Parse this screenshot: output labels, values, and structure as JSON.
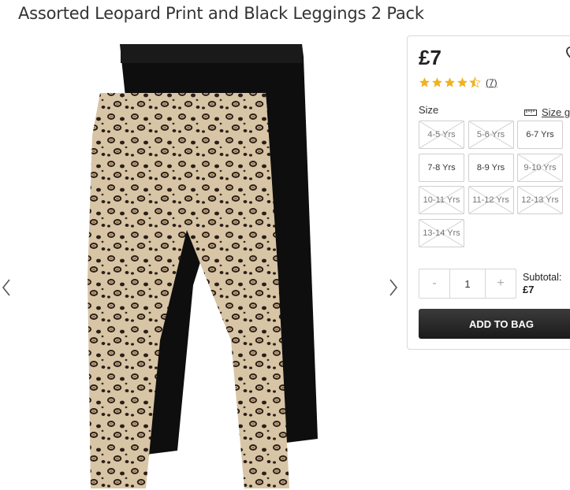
{
  "product": {
    "title": "Assorted Leopard Print and Black Leggings 2 Pack",
    "price": "£7",
    "rating": 4.5,
    "review_count": "(7)"
  },
  "size_section": {
    "label": "Size",
    "guide_label": "Size gu",
    "options": [
      {
        "label": "4-5 Yrs",
        "available": false
      },
      {
        "label": "5-6 Yrs",
        "available": false
      },
      {
        "label": "6-7 Yrs",
        "available": true
      },
      {
        "label": "7-8 Yrs",
        "available": true
      },
      {
        "label": "8-9 Yrs",
        "available": true
      },
      {
        "label": "9-10 Yrs",
        "available": false
      },
      {
        "label": "10-11 Yrs",
        "available": false
      },
      {
        "label": "11-12 Yrs",
        "available": false
      },
      {
        "label": "12-13 Yrs",
        "available": false
      },
      {
        "label": "13-14 Yrs",
        "available": false
      }
    ]
  },
  "quantity": {
    "minus": "-",
    "plus": "+",
    "value": "1"
  },
  "subtotal": {
    "label": "Subtotal:",
    "value": "£7"
  },
  "add_to_bag": "ADD TO BAG",
  "colors": {
    "leopard_base": "#d6c2a4",
    "leopard_spot": "#2a1f18",
    "black_leggings": "#0e0e0e",
    "star": "#f0b21e",
    "button_dark": "#222222"
  }
}
